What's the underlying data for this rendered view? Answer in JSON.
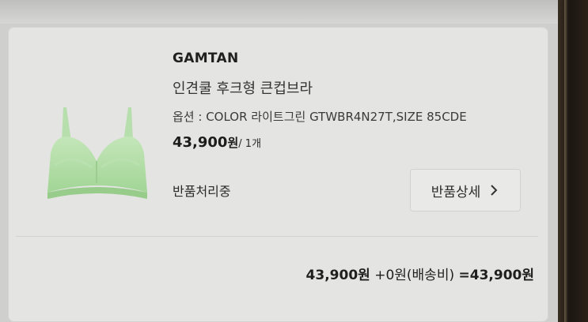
{
  "order_item": {
    "brand": "GAMTAN",
    "product_name": "인견쿨 후크형 큰컵브라",
    "option_label": "옵션 : ",
    "option_value": "COLOR 라이트그린 GTWBR4N27T,SIZE 85CDE",
    "price": "43,900",
    "price_unit": "원",
    "quantity": "/ 1개",
    "status": "반품처리중",
    "detail_button_label": "반품상세",
    "thumbnail_color": "#a9d8a0"
  },
  "summary": {
    "product_total": "43,900원",
    "shipping": "+0원(배송비)",
    "grand_total": "=43,900원"
  }
}
